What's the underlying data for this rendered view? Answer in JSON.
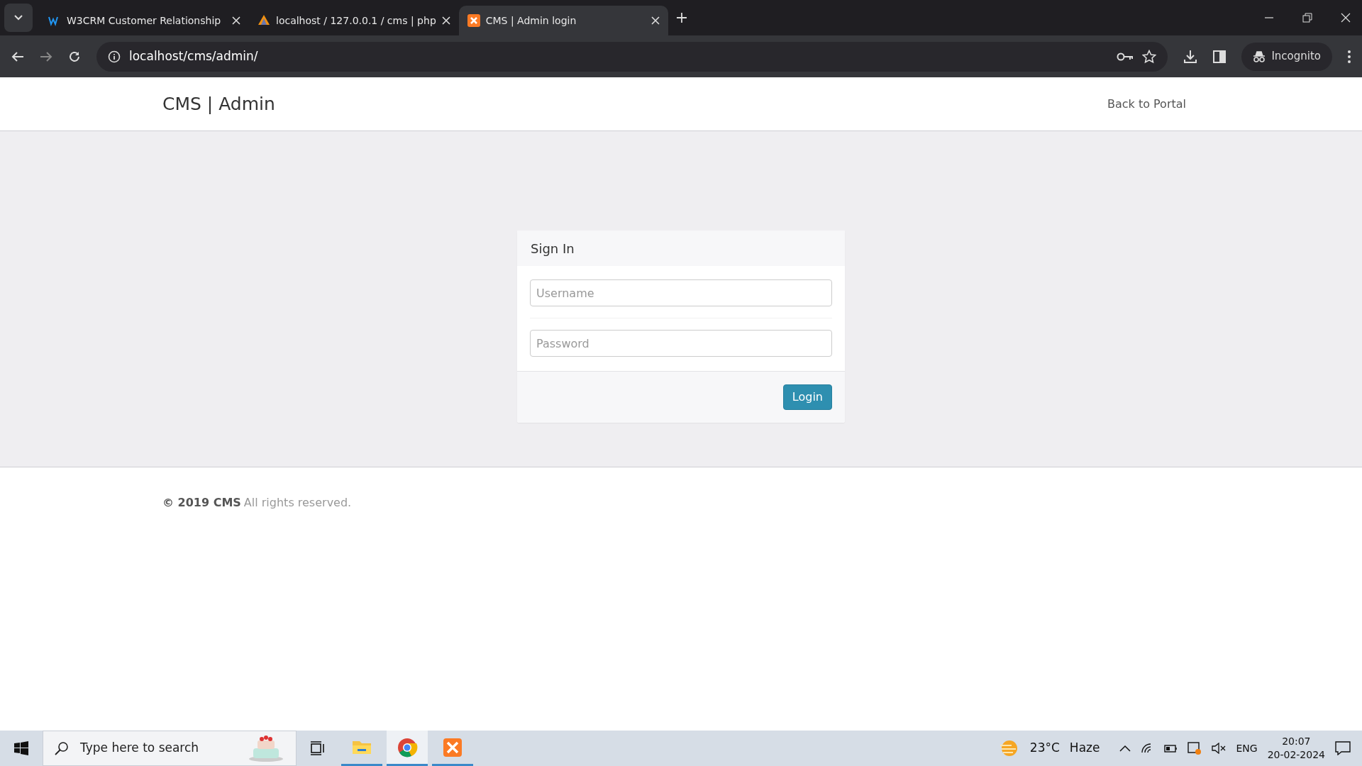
{
  "browser": {
    "tabs": [
      {
        "title": "W3CRM Customer Relationship",
        "kind": "w3",
        "selected": false
      },
      {
        "title": "localhost / 127.0.0.1 / cms | php",
        "kind": "pma",
        "selected": false
      },
      {
        "title": "CMS | Admin login",
        "kind": "xampp",
        "selected": true
      }
    ],
    "address": "localhost/cms/admin/",
    "profile": "Incognito"
  },
  "header": {
    "brand": "CMS | Admin",
    "link": "Back to Portal"
  },
  "card": {
    "title": "Sign In",
    "fields": [
      {
        "placeholder": "Username"
      },
      {
        "placeholder": "Password"
      }
    ],
    "button": "Login"
  },
  "footer": {
    "owner": "© 2019 CMS",
    "rights": "All rights reserved."
  },
  "taskbar": {
    "search": {
      "placeholder": "Type here to search"
    },
    "apps": [
      {
        "kind": "folder",
        "selected": false
      },
      {
        "kind": "chrome",
        "selected": true
      },
      {
        "kind": "xampp",
        "selected": false
      }
    ],
    "weather": {
      "temp": "23°C",
      "text": "Haze"
    },
    "language": "ENG",
    "time": "20:07",
    "date": "20-02-2024"
  }
}
